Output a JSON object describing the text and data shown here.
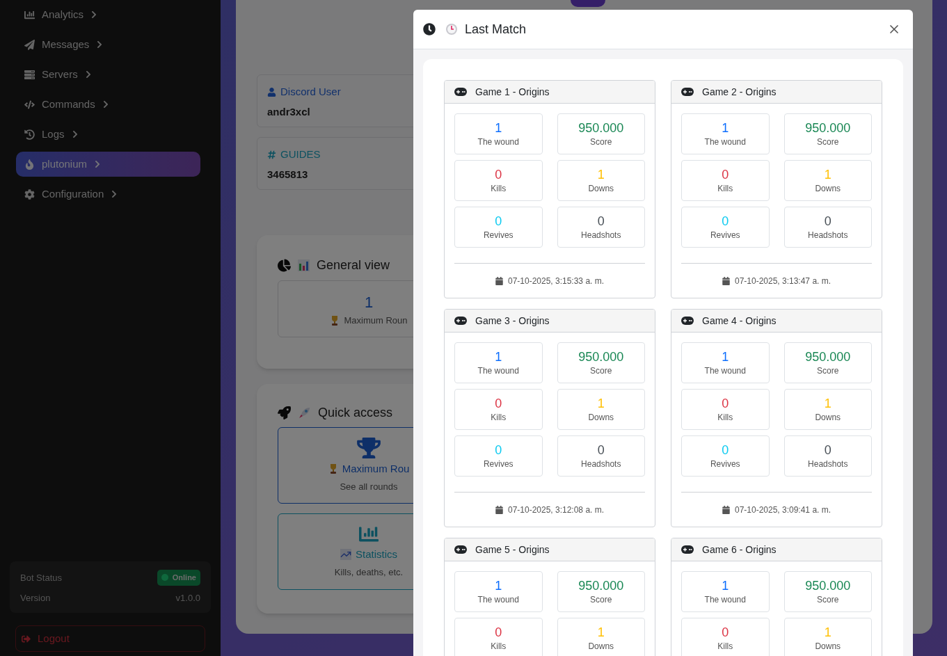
{
  "sidebar": {
    "items": [
      {
        "label": "Analytics",
        "selected": false
      },
      {
        "label": "Messages",
        "selected": false
      },
      {
        "label": "Servers",
        "selected": false
      },
      {
        "label": "Commands",
        "selected": false
      },
      {
        "label": "Logs",
        "selected": false
      },
      {
        "label": "plutonium",
        "selected": true
      },
      {
        "label": "Configuration",
        "selected": false
      }
    ],
    "status": {
      "label": "Bot Status",
      "badge": "Online",
      "version_label": "Version",
      "version": "v1.0.0"
    },
    "logout": "Logout"
  },
  "main": {
    "info_cards": [
      {
        "title": "Discord User",
        "value": "andr3xcl"
      },
      {
        "title": "GUIDES",
        "value": "3465813"
      }
    ],
    "general_view": {
      "title": "General view",
      "stat_value": "1",
      "stat_label": "Maximum Roun"
    },
    "quick_access": {
      "title": "Quick access",
      "links": [
        {
          "title": "Maximum Rou",
          "subtitle": "See all rounds"
        },
        {
          "title": "Statistics",
          "subtitle": "Kills, deaths, etc."
        }
      ]
    }
  },
  "modal": {
    "title": "Last Match",
    "games": [
      {
        "title": "Game 1 - Origins",
        "date": "07-10-2025, 3:15:33 a. m.",
        "stats": [
          {
            "value": "1",
            "label": "The wound",
            "color": "#0d6efd"
          },
          {
            "value": "950.000",
            "label": "Score",
            "color": "#198754"
          },
          {
            "value": "0",
            "label": "Kills",
            "color": "#dc3545"
          },
          {
            "value": "1",
            "label": "Downs",
            "color": "#ffc107"
          },
          {
            "value": "0",
            "label": "Revives",
            "color": "#0dcaf0"
          },
          {
            "value": "0",
            "label": "Headshots",
            "color": "#495057"
          }
        ]
      },
      {
        "title": "Game 2 - Origins",
        "date": "07-10-2025, 3:13:47 a. m.",
        "stats": [
          {
            "value": "1",
            "label": "The wound",
            "color": "#0d6efd"
          },
          {
            "value": "950.000",
            "label": "Score",
            "color": "#198754"
          },
          {
            "value": "0",
            "label": "Kills",
            "color": "#dc3545"
          },
          {
            "value": "1",
            "label": "Downs",
            "color": "#ffc107"
          },
          {
            "value": "0",
            "label": "Revives",
            "color": "#0dcaf0"
          },
          {
            "value": "0",
            "label": "Headshots",
            "color": "#495057"
          }
        ]
      },
      {
        "title": "Game 3 - Origins",
        "date": "07-10-2025, 3:12:08 a. m.",
        "stats": [
          {
            "value": "1",
            "label": "The wound",
            "color": "#0d6efd"
          },
          {
            "value": "950.000",
            "label": "Score",
            "color": "#198754"
          },
          {
            "value": "0",
            "label": "Kills",
            "color": "#dc3545"
          },
          {
            "value": "1",
            "label": "Downs",
            "color": "#ffc107"
          },
          {
            "value": "0",
            "label": "Revives",
            "color": "#0dcaf0"
          },
          {
            "value": "0",
            "label": "Headshots",
            "color": "#495057"
          }
        ]
      },
      {
        "title": "Game 4 - Origins",
        "date": "07-10-2025, 3:09:41 a. m.",
        "stats": [
          {
            "value": "1",
            "label": "The wound",
            "color": "#0d6efd"
          },
          {
            "value": "950.000",
            "label": "Score",
            "color": "#198754"
          },
          {
            "value": "0",
            "label": "Kills",
            "color": "#dc3545"
          },
          {
            "value": "1",
            "label": "Downs",
            "color": "#ffc107"
          },
          {
            "value": "0",
            "label": "Revives",
            "color": "#0dcaf0"
          },
          {
            "value": "0",
            "label": "Headshots",
            "color": "#495057"
          }
        ]
      },
      {
        "title": "Game 5 - Origins",
        "stats": [
          {
            "value": "1",
            "label": "The wound",
            "color": "#0d6efd"
          },
          {
            "value": "950.000",
            "label": "Score",
            "color": "#198754"
          },
          {
            "value": "0",
            "label": "Kills",
            "color": "#dc3545"
          },
          {
            "value": "1",
            "label": "Downs",
            "color": "#ffc107"
          }
        ]
      },
      {
        "title": "Game 6 - Origins",
        "stats": [
          {
            "value": "1",
            "label": "The wound",
            "color": "#0d6efd"
          },
          {
            "value": "950.000",
            "label": "Score",
            "color": "#198754"
          },
          {
            "value": "0",
            "label": "Kills",
            "color": "#dc3545"
          },
          {
            "value": "1",
            "label": "Downs",
            "color": "#ffc107"
          }
        ]
      }
    ]
  }
}
